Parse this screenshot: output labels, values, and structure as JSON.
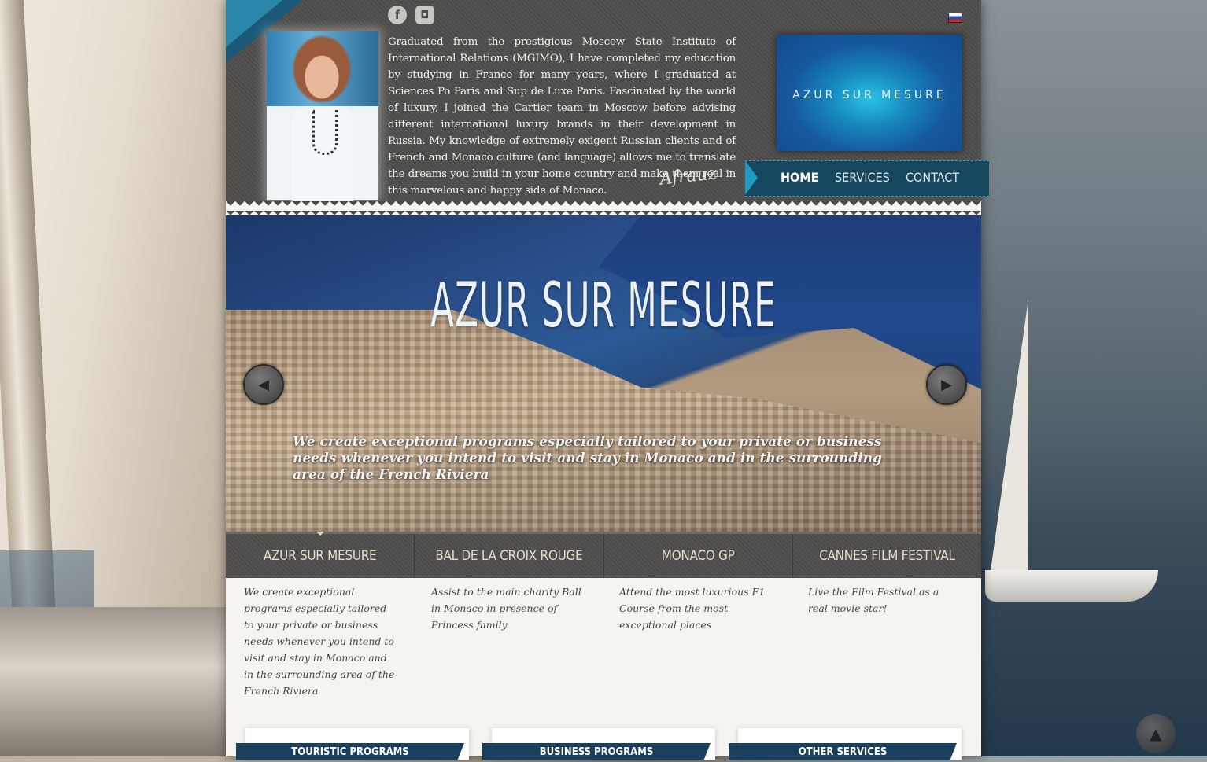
{
  "header": {
    "social": [
      {
        "name": "facebook",
        "glyph": "f"
      },
      {
        "name": "instagram",
        "glyph": "◘"
      }
    ],
    "language": "ru",
    "bio": "Graduated from the prestigious Moscow State Institute of International Relations (MGIMO), I have completed my education by studying in France for many years, where I graduated at Sciences Po Paris and Sup de Luxe Paris. Fascinated by the world of luxury, I joined the Cartier team in Moscow before advising different international luxury brands in their development in Russia. My knowledge of extremely exigent Russian clients and of French and Monaco culture (and language) allows me to translate the dreams you build in your home country and make them real in this marvelous and happy side of Monaco.",
    "signature": "Afrauz",
    "logo": "AZUR SUR MESURE",
    "nav": [
      "HOME",
      "SERVICES",
      "CONTACT"
    ]
  },
  "slider": {
    "title": "AZUR SUR MESURE",
    "caption": "We create exceptional programs especially tailored to your private or business needs whenever you intend to visit and stay in Monaco and in the surrounding area of the French Riviera",
    "prev": "◀",
    "next": "▶"
  },
  "tabs": [
    {
      "label": "AZUR SUR MESURE",
      "desc": "We create exceptional programs especially tailored to your private or business needs whenever you intend to visit and stay in Monaco and in the surrounding area of the French Riviera"
    },
    {
      "label": "BAL DE LA CROIX ROUGE",
      "desc": "Assist to the main charity Ball in Monaco in presence of Princess family"
    },
    {
      "label": "MONACO GP",
      "desc": "Attend the most luxurious F1 Course from the most exceptional places"
    },
    {
      "label": "CANNES FILM FESTIVAL",
      "desc": "Live the Film Festival as a real movie star!"
    }
  ],
  "cards": [
    "TOURISTIC PROGRAMS",
    "BUSINESS PROGRAMS",
    "OTHER SERVICES"
  ],
  "scroll_top": "▲",
  "colors": {
    "accent": "#16475e",
    "header": "#4e4d4b",
    "logo": "#1659a0"
  }
}
